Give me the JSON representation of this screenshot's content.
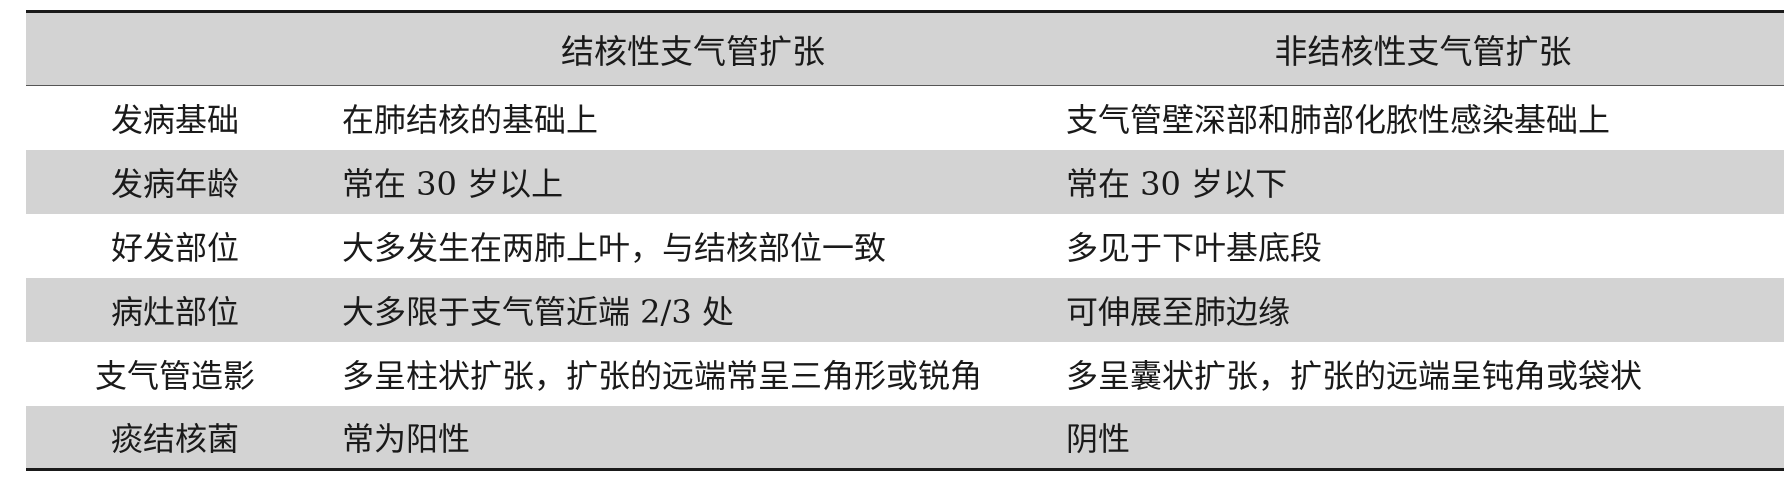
{
  "table": {
    "headers": [
      "",
      "结核性支气管扩张",
      "非结核性支气管扩张"
    ],
    "rows": [
      {
        "label": "发病基础",
        "tb": "在肺结核的基础上",
        "non_tb": "支气管壁深部和肺部化脓性感染基础上"
      },
      {
        "label": "发病年龄",
        "tb": "常在 30 岁以上",
        "non_tb": "常在 30 岁以下"
      },
      {
        "label": "好发部位",
        "tb": "大多发生在两肺上叶，与结核部位一致",
        "non_tb": "多见于下叶基底段"
      },
      {
        "label": "病灶部位",
        "tb": "大多限于支气管近端 2/3 处",
        "non_tb": "可伸展至肺边缘"
      },
      {
        "label": "支气管造影",
        "tb": "多呈柱状扩张，扩张的远端常呈三角形或锐角",
        "non_tb": "多呈囊状扩张，扩张的远端呈钝角或袋状"
      },
      {
        "label": "痰结核菌",
        "tb": "常为阳性",
        "non_tb": "阴性"
      }
    ]
  },
  "colors": {
    "band": "#d3d3d3",
    "rule": "#1a1a1a"
  }
}
